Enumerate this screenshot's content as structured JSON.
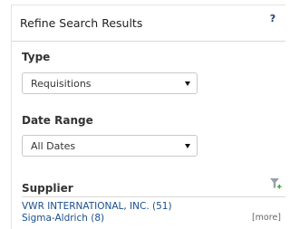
{
  "panel": {
    "title": "Refine Search Results",
    "help_label": "?"
  },
  "type_filter": {
    "label": "Type",
    "selected": "Requisitions"
  },
  "date_filter": {
    "label": "Date Range",
    "selected": "All Dates"
  },
  "supplier_filter": {
    "label": "Supplier",
    "icon": "filter-add-icon",
    "items": [
      {
        "label": "VWR INTERNATIONAL, INC. (51)"
      },
      {
        "label": "Sigma-Aldrich (8)"
      }
    ],
    "more_label": "[more]"
  },
  "colors": {
    "link": "#1a4f8b",
    "filter_icon": "#9aa1a6",
    "filter_plus": "#3fa535"
  }
}
